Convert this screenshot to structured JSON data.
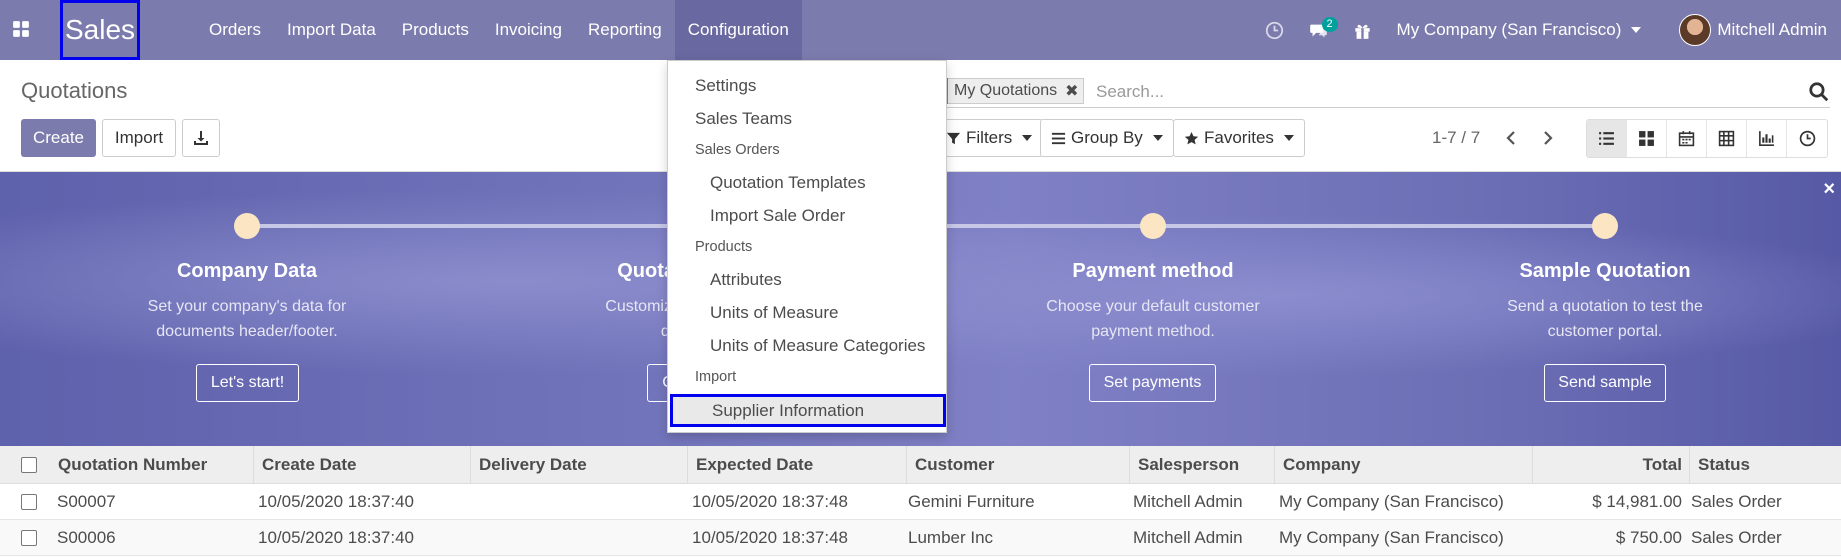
{
  "navbar": {
    "brand": "Sales",
    "menu": [
      "Orders",
      "Import Data",
      "Products",
      "Invoicing",
      "Reporting",
      "Configuration"
    ],
    "active_menu": "Configuration",
    "messages_badge": "2",
    "company": "My Company (San Francisco)",
    "user": "Mitchell Admin"
  },
  "control_panel": {
    "title": "Quotations",
    "create_label": "Create",
    "import_label": "Import",
    "facet": "My Quotations",
    "search_placeholder": "Search...",
    "filters_label": "Filters",
    "groupby_label": "Group By",
    "favorites_label": "Favorites",
    "pager": "1-7 / 7",
    "views": [
      "list-icon",
      "kanban-icon",
      "calendar-icon",
      "pivot-icon",
      "graph-icon",
      "activity-icon"
    ]
  },
  "onboarding": {
    "close": "×",
    "steps": [
      {
        "title": "Company Data",
        "desc1": "Set your company's data for",
        "desc2": "documents header/footer.",
        "button": "Let's start!"
      },
      {
        "title": "Quotation Layout",
        "desc1": "Customize the look of your",
        "desc2": "quotations.",
        "button": "Customize"
      },
      {
        "title": "Payment method",
        "desc1": "Choose your default customer",
        "desc2": "payment method.",
        "button": "Set payments"
      },
      {
        "title": "Sample Quotation",
        "desc1": "Send a quotation to test the",
        "desc2": "customer portal.",
        "button": "Send sample"
      }
    ]
  },
  "dropdown": {
    "items": [
      {
        "type": "item",
        "label": "Settings"
      },
      {
        "type": "item",
        "label": "Sales Teams"
      },
      {
        "type": "header",
        "label": "Sales Orders"
      },
      {
        "type": "subitem",
        "label": "Quotation Templates"
      },
      {
        "type": "subitem",
        "label": "Import Sale Order"
      },
      {
        "type": "header",
        "label": "Products"
      },
      {
        "type": "subitem",
        "label": "Attributes"
      },
      {
        "type": "subitem",
        "label": "Units of Measure"
      },
      {
        "type": "subitem",
        "label": "Units of Measure Categories"
      },
      {
        "type": "header",
        "label": "Import"
      },
      {
        "type": "subitem",
        "label": "Supplier Information"
      }
    ]
  },
  "table": {
    "columns": [
      "Quotation Number",
      "Create Date",
      "Delivery Date",
      "Expected Date",
      "Customer",
      "Salesperson",
      "Company",
      "Total",
      "Status"
    ],
    "rows": [
      [
        "S00007",
        "10/05/2020 18:37:40",
        "",
        "10/05/2020 18:37:48",
        "Gemini Furniture",
        "Mitchell Admin",
        "My Company (San Francisco)",
        "$ 14,981.00",
        "Sales Order"
      ],
      [
        "S00006",
        "10/05/2020 18:37:40",
        "",
        "10/05/2020 18:37:48",
        "Lumber Inc",
        "Mitchell Admin",
        "My Company (San Francisco)",
        "$ 750.00",
        "Sales Order"
      ]
    ]
  },
  "colors": {
    "brand": "#7c7bad",
    "highlight_border": "#0000ee",
    "badge": "#00a09d"
  }
}
